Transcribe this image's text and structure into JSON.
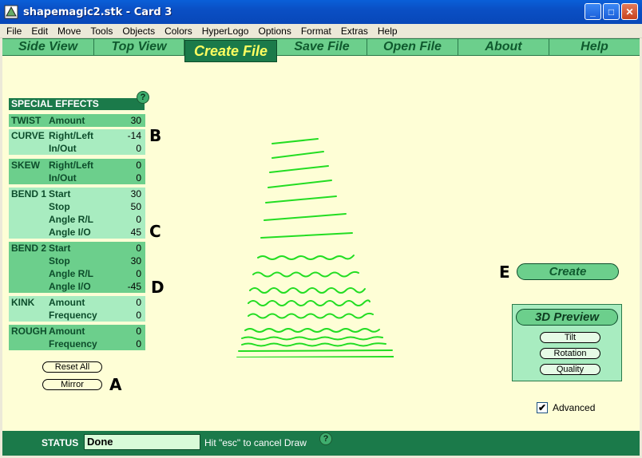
{
  "window": {
    "title": "shapemagic2.stk - Card 3"
  },
  "menu": [
    "File",
    "Edit",
    "Move",
    "Tools",
    "Objects",
    "Colors",
    "HyperLogo",
    "Options",
    "Format",
    "Extras",
    "Help"
  ],
  "nav": {
    "tabs": [
      {
        "label": "Side View"
      },
      {
        "label": "Top View"
      },
      {
        "label": "Create File",
        "active": true
      },
      {
        "label": "Save File"
      },
      {
        "label": "Open File"
      },
      {
        "label": "About"
      },
      {
        "label": "Help"
      }
    ]
  },
  "effects": {
    "header": "SPECIAL EFFECTS",
    "help": "?",
    "groups": [
      {
        "name": "TWIST",
        "rows": [
          {
            "param": "Amount",
            "value": "30"
          }
        ]
      },
      {
        "name": "CURVE",
        "rows": [
          {
            "param": "Right/Left",
            "value": "-14"
          },
          {
            "param": "In/Out",
            "value": "0"
          }
        ]
      },
      {
        "name": "SKEW",
        "rows": [
          {
            "param": "Right/Left",
            "value": "0"
          },
          {
            "param": "In/Out",
            "value": "0"
          }
        ]
      },
      {
        "name": "BEND 1",
        "rows": [
          {
            "param": "Start",
            "value": "30"
          },
          {
            "param": "Stop",
            "value": "50"
          },
          {
            "param": "Angle R/L",
            "value": "0"
          },
          {
            "param": "Angle I/O",
            "value": "45"
          }
        ]
      },
      {
        "name": "BEND 2",
        "rows": [
          {
            "param": "Start",
            "value": "0"
          },
          {
            "param": "Stop",
            "value": "30"
          },
          {
            "param": "Angle R/L",
            "value": "0"
          },
          {
            "param": "Angle I/O",
            "value": "-45"
          }
        ]
      },
      {
        "name": "KINK",
        "rows": [
          {
            "param": "Amount",
            "value": "0"
          },
          {
            "param": "Frequency",
            "value": "0"
          }
        ]
      },
      {
        "name": "ROUGH",
        "rows": [
          {
            "param": "Amount",
            "value": "0"
          },
          {
            "param": "Frequency",
            "value": "0"
          }
        ]
      }
    ],
    "reset_label": "Reset All",
    "mirror_label": "Mirror"
  },
  "annotations": {
    "a": "A",
    "b": "B",
    "c": "C",
    "d": "D",
    "e": "E"
  },
  "create": {
    "label": "Create"
  },
  "preview": {
    "title": "3D Preview",
    "tilt": "Tilt",
    "rotation": "Rotation",
    "quality": "Quality"
  },
  "advanced": {
    "label": "Advanced",
    "checked": true
  },
  "status": {
    "label": "STATUS",
    "value": "Done",
    "hint": "Hit \"esc\" to cancel Draw",
    "help": "?"
  },
  "colors": {
    "accent_dark": "#1b7a4a",
    "accent_light": "#6ccf8c",
    "shape_stroke": "#22dd22",
    "background": "#fefed6"
  }
}
